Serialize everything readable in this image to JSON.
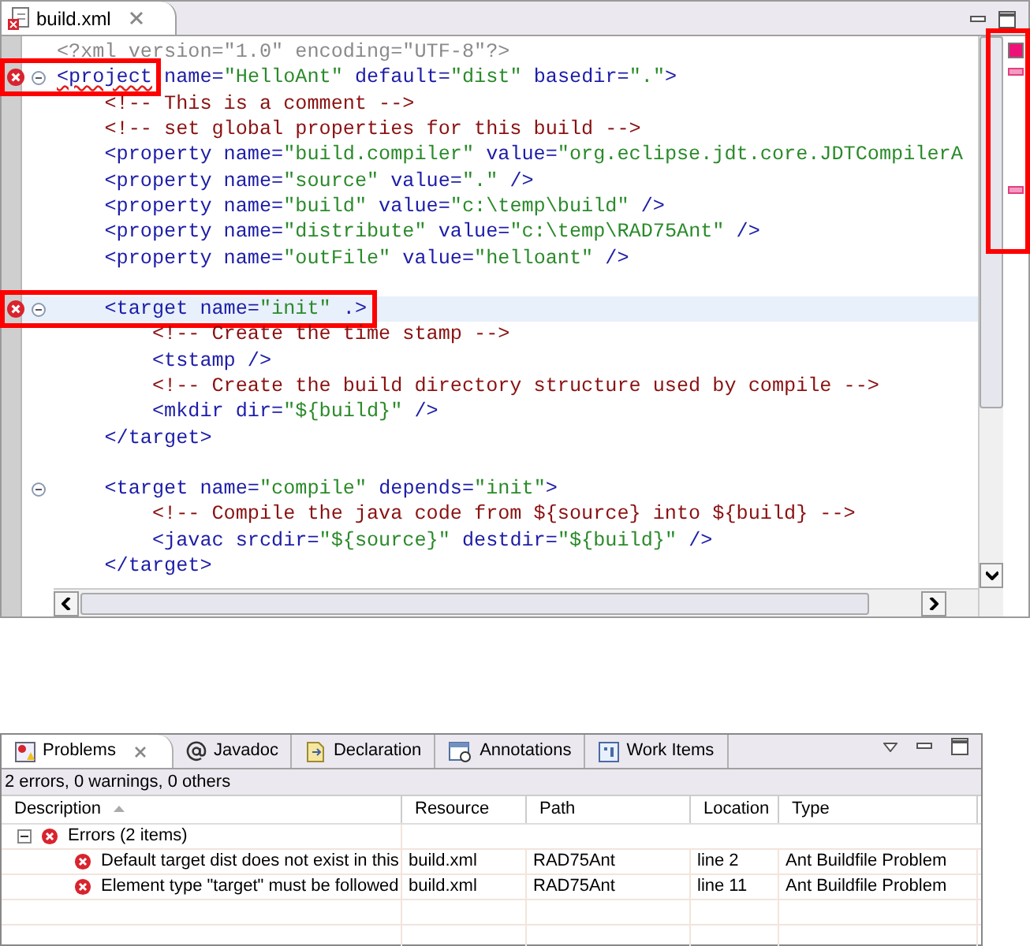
{
  "editor": {
    "tab": {
      "label": "build.xml",
      "selected": true
    },
    "lines": [
      {
        "tokens": [
          {
            "kind": "pi",
            "text": "<?xml version=\"1.0\" encoding=\"UTF-8\"?>"
          }
        ]
      },
      {
        "error": true,
        "foldable": true,
        "tokens": [
          {
            "kind": "error_tag",
            "text": "<project",
            "framed": true
          },
          {
            "kind": "tag",
            "text": " name="
          },
          {
            "kind": "value",
            "text": "\"HelloAnt\""
          },
          {
            "kind": "tag",
            "text": " default="
          },
          {
            "kind": "value",
            "text": "\"dist\""
          },
          {
            "kind": "tag",
            "text": " basedir="
          },
          {
            "kind": "value",
            "text": "\".\""
          },
          {
            "kind": "tag",
            "text": ">"
          }
        ]
      },
      {
        "tokens": [
          {
            "kind": "comment",
            "text": "    <!-- This is a comment -->"
          }
        ]
      },
      {
        "tokens": [
          {
            "kind": "comment",
            "text": "    <!-- set global properties for this build -->"
          }
        ]
      },
      {
        "tokens": [
          {
            "kind": "tag",
            "text": "    <property name="
          },
          {
            "kind": "value",
            "text": "\"build.compiler\""
          },
          {
            "kind": "tag",
            "text": " value="
          },
          {
            "kind": "value",
            "text": "\"org.eclipse.jdt.core.JDTCompilerA"
          }
        ]
      },
      {
        "tokens": [
          {
            "kind": "tag",
            "text": "    <property name="
          },
          {
            "kind": "value",
            "text": "\"source\""
          },
          {
            "kind": "tag",
            "text": " value="
          },
          {
            "kind": "value",
            "text": "\".\""
          },
          {
            "kind": "tag",
            "text": " />"
          }
        ]
      },
      {
        "tokens": [
          {
            "kind": "tag",
            "text": "    <property name="
          },
          {
            "kind": "value",
            "text": "\"build\""
          },
          {
            "kind": "tag",
            "text": " value="
          },
          {
            "kind": "value",
            "text": "\"c:\\temp\\build\""
          },
          {
            "kind": "tag",
            "text": " />"
          }
        ]
      },
      {
        "tokens": [
          {
            "kind": "tag",
            "text": "    <property name="
          },
          {
            "kind": "value",
            "text": "\"distribute\""
          },
          {
            "kind": "tag",
            "text": " value="
          },
          {
            "kind": "value",
            "text": "\"c:\\temp\\RAD75Ant\""
          },
          {
            "kind": "tag",
            "text": " />"
          }
        ]
      },
      {
        "tokens": [
          {
            "kind": "tag",
            "text": "    <property name="
          },
          {
            "kind": "value",
            "text": "\"outFile\""
          },
          {
            "kind": "tag",
            "text": " value="
          },
          {
            "kind": "value",
            "text": "\"helloant\""
          },
          {
            "kind": "tag",
            "text": " />"
          }
        ]
      },
      {
        "gap_before": true,
        "error": true,
        "foldable": true,
        "current": true,
        "tokens": [
          {
            "kind": "tag",
            "text": "    <target name=",
            "framed": true
          },
          {
            "kind": "value",
            "text": "\"init\"",
            "framed": true
          },
          {
            "kind": "tag",
            "text": " .>",
            "framed": true
          }
        ]
      },
      {
        "tokens": [
          {
            "kind": "comment",
            "text": "        <!-- Create the time stamp -->"
          }
        ]
      },
      {
        "tokens": [
          {
            "kind": "tag",
            "text": "        <tstamp />"
          }
        ]
      },
      {
        "tokens": [
          {
            "kind": "comment",
            "text": "        <!-- Create the build directory structure used by compile -->"
          }
        ]
      },
      {
        "tokens": [
          {
            "kind": "tag",
            "text": "        <mkdir dir="
          },
          {
            "kind": "value",
            "text": "\"${build}\""
          },
          {
            "kind": "tag",
            "text": " />"
          }
        ]
      },
      {
        "tokens": [
          {
            "kind": "tag",
            "text": "    </target>"
          }
        ]
      },
      {
        "gap_before": true,
        "foldable": true,
        "tokens": [
          {
            "kind": "tag",
            "text": "    <target name="
          },
          {
            "kind": "value",
            "text": "\"compile\""
          },
          {
            "kind": "tag",
            "text": " depends="
          },
          {
            "kind": "value",
            "text": "\"init\""
          },
          {
            "kind": "tag",
            "text": ">"
          }
        ]
      },
      {
        "tokens": [
          {
            "kind": "comment",
            "text": "        <!-- Compile the java code from ${source} into ${build} -->"
          }
        ]
      },
      {
        "tokens": [
          {
            "kind": "tag",
            "text": "        <javac srcdir="
          },
          {
            "kind": "value",
            "text": "\"${source}\""
          },
          {
            "kind": "tag",
            "text": " destdir="
          },
          {
            "kind": "value",
            "text": "\"${build}\""
          },
          {
            "kind": "tag",
            "text": " />"
          }
        ]
      },
      {
        "tokens": [
          {
            "kind": "tag",
            "text": "    </target>"
          }
        ]
      }
    ],
    "overview_ruler": {
      "framed": true
    }
  },
  "problems": {
    "tabs": [
      {
        "label": "Problems",
        "selected": true,
        "kind": "problems"
      },
      {
        "label": "Javadoc",
        "selected": false,
        "kind": "javadoc"
      },
      {
        "label": "Declaration",
        "selected": false,
        "kind": "declaration"
      },
      {
        "label": "Annotations",
        "selected": false,
        "kind": "annotations"
      },
      {
        "label": "Work Items",
        "selected": false,
        "kind": "workitems"
      }
    ],
    "summary": "2 errors, 0 warnings, 0 others",
    "columns": [
      {
        "label": "Description",
        "sorted": true
      },
      {
        "label": "Resource",
        "sorted": false
      },
      {
        "label": "Path",
        "sorted": false
      },
      {
        "label": "Location",
        "sorted": false
      },
      {
        "label": "Type",
        "sorted": false
      }
    ],
    "groups": [
      {
        "label": "Errors (2 items)",
        "expanded": true,
        "children": [
          {
            "description": "Default target dist does not exist in this",
            "resource": "build.xml",
            "path": "RAD75Ant",
            "location": "line 2",
            "type": "Ant Buildfile Problem"
          },
          {
            "description": "Element type \"target\" must be followed",
            "resource": "build.xml",
            "path": "RAD75Ant",
            "location": "line 11",
            "type": "Ant Buildfile Problem"
          }
        ]
      }
    ]
  }
}
